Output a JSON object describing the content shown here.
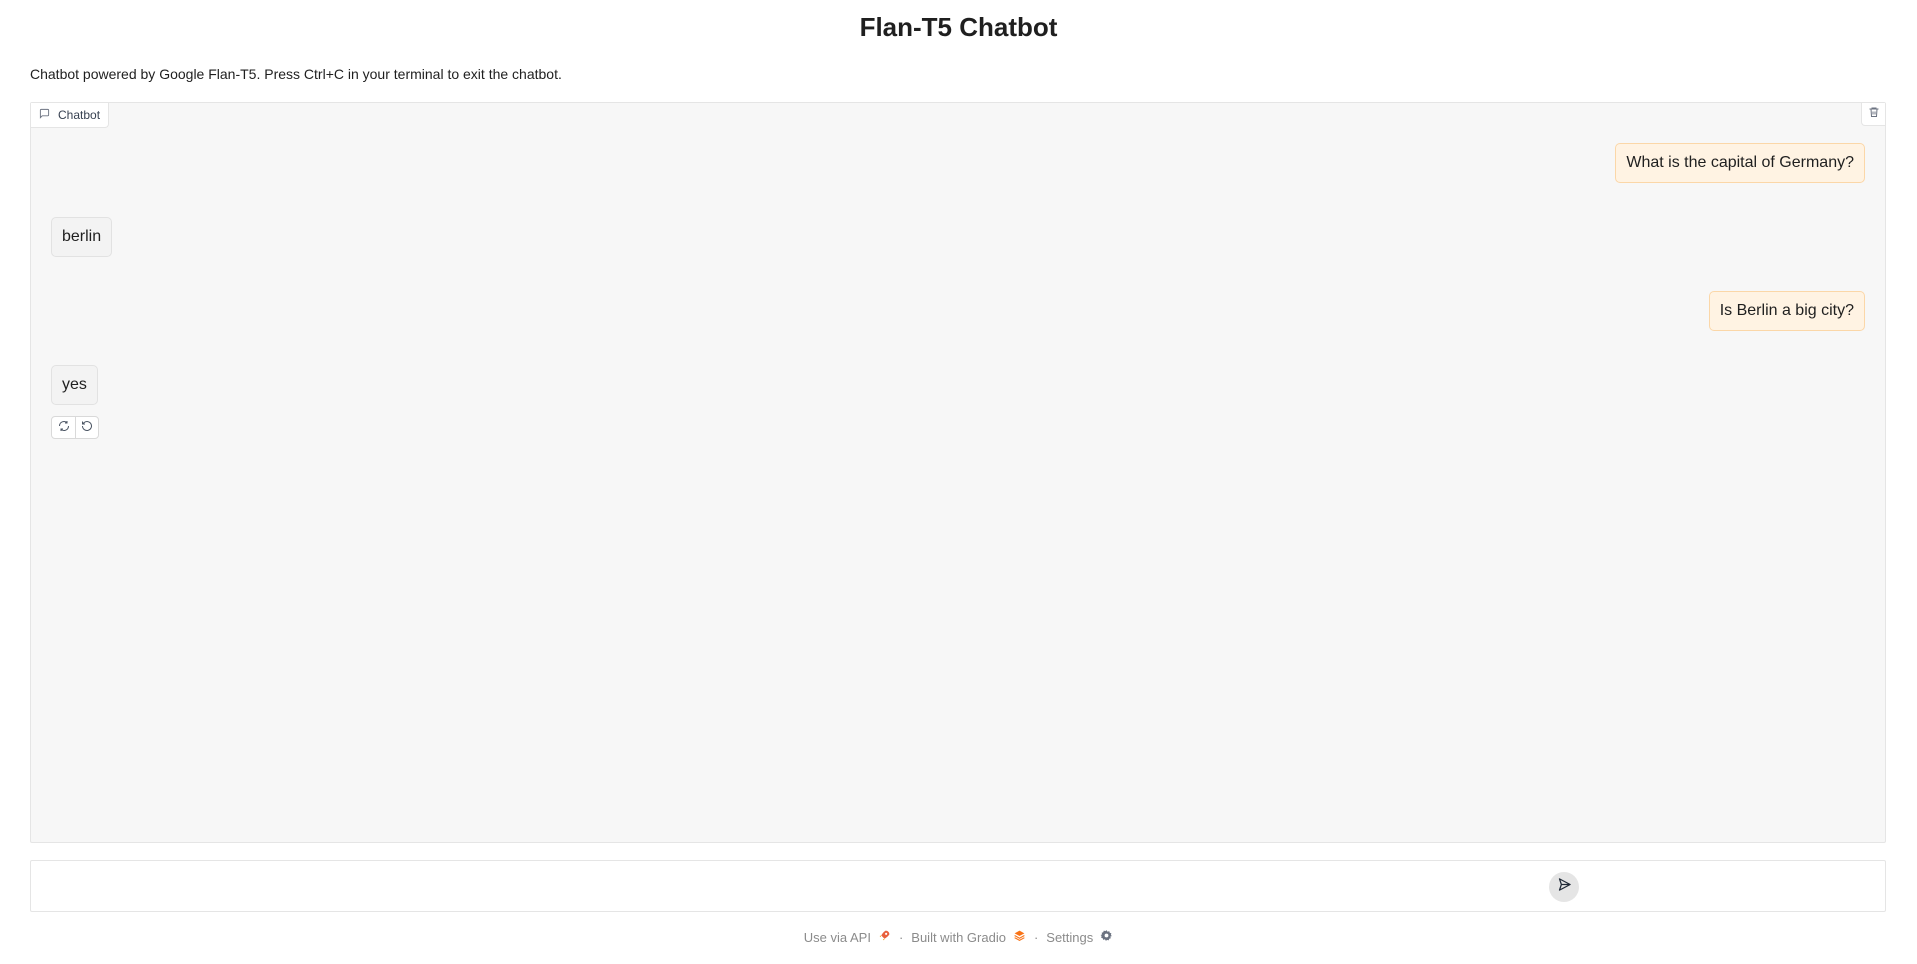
{
  "header": {
    "title": "Flan-T5 Chatbot",
    "description": "Chatbot powered by Google Flan-T5. Press Ctrl+C in your terminal to exit the chatbot."
  },
  "chatbot": {
    "label": "Chatbot",
    "label_icon": "chat-icon",
    "clear_icon": "trash-icon",
    "messages": [
      {
        "role": "user",
        "text": "What is the capital of Germany?"
      },
      {
        "role": "bot",
        "text": "berlin"
      },
      {
        "role": "user",
        "text": "Is Berlin a big city?"
      },
      {
        "role": "bot",
        "text": "yes"
      }
    ],
    "message_actions": [
      {
        "name": "retry",
        "icon": "refresh-icon"
      },
      {
        "name": "undo",
        "icon": "undo-icon"
      }
    ]
  },
  "input": {
    "value": "",
    "placeholder": "",
    "send_icon": "send-icon"
  },
  "footer": {
    "api_label": "Use via API",
    "built_label": "Built with Gradio",
    "settings_label": "Settings",
    "separator": "·"
  },
  "colors": {
    "user_bubble": "#fff3e3",
    "user_border": "#fbd7a8",
    "bot_bubble": "#f3f3f3",
    "chat_background": "#f7f7f7"
  }
}
